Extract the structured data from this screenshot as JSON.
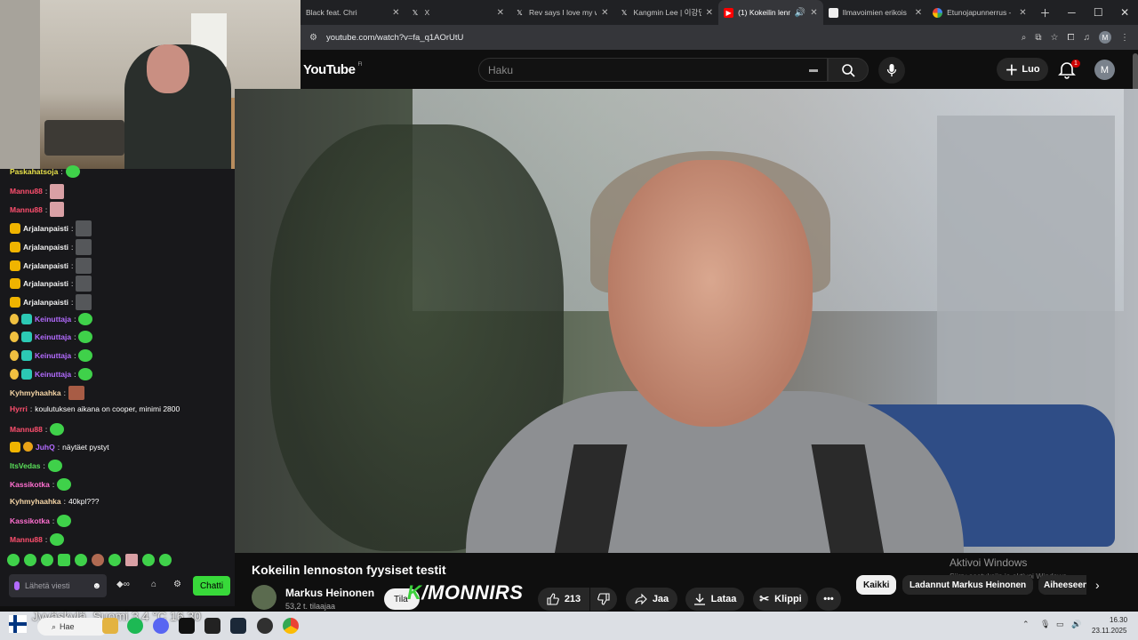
{
  "browser": {
    "tabs": [
      {
        "label": "Black feat. Chri",
        "icon": "x-icon"
      },
      {
        "label": "X",
        "icon": "x-icon"
      },
      {
        "label": "Rev says I love my w",
        "icon": "x-icon"
      },
      {
        "label": "Kangmin Lee | 이강민",
        "icon": "x-icon"
      },
      {
        "label": "(1) Kokeilin lenn",
        "icon": "youtube-icon",
        "active": true
      },
      {
        "label": "Ilmavoimien erikois",
        "icon": "page-icon"
      },
      {
        "label": "Etunojapunnerrus - ",
        "icon": "google-icon"
      }
    ],
    "url": "youtube.com/watch?v=fa_q1AOrUtU",
    "profile_initial": "M"
  },
  "youtube": {
    "logo": "YouTube",
    "region": "FI",
    "search_placeholder": "Haku",
    "create_label": "Luo",
    "notification_count": "1",
    "avatar_initial": "M",
    "video_title": "Kokeilin lennoston fyysiset testit",
    "channel_name": "Markus Heinonen",
    "subscribers": "53,2 t. tilaajaa",
    "subscribe_label": "Tila",
    "overlay_logo_k": "K",
    "overlay_logo_rest": "/MONNIRS",
    "likes": "213",
    "share_label": "Jaa",
    "download_label": "Lataa",
    "clip_label": "Klippi",
    "chips": [
      "Kaikki",
      "Ladannut Markus Heinonen",
      "Aiheeseen"
    ],
    "watermark_title": "Aktivoi Windows",
    "watermark_sub": "Siirry asetuksiin ja aktivoi Windows."
  },
  "chat": {
    "messages": [
      {
        "user": "Paskahatsoja",
        "color": "#e8e14a",
        "text": "",
        "emote": "green"
      },
      {
        "user": "Mannu88",
        "color": "#ff4f6e",
        "text": "",
        "emote": "pink"
      },
      {
        "user": "Mannu88",
        "color": "#ff4f6e",
        "text": "",
        "emote": "pink"
      },
      {
        "user": "Arjalanpaisti",
        "color": "#f2f2f2",
        "text": "",
        "emote": "dark",
        "badges": [
          "crown"
        ]
      },
      {
        "user": "Arjalanpaisti",
        "color": "#f2f2f2",
        "text": "",
        "emote": "dark",
        "badges": [
          "crown"
        ]
      },
      {
        "user": "Arjalanpaisti",
        "color": "#f2f2f2",
        "text": "",
        "emote": "dark",
        "badges": [
          "crown"
        ]
      },
      {
        "user": "Arjalanpaisti",
        "color": "#f2f2f2",
        "text": "",
        "emote": "dark",
        "badges": [
          "crown"
        ]
      },
      {
        "user": "Arjalanpaisti",
        "color": "#f2f2f2",
        "text": "",
        "emote": "dark",
        "badges": [
          "crown"
        ]
      },
      {
        "user": "Keinuttaja",
        "color": "#b36bff",
        "text": "",
        "emote": "green",
        "badges": [
          "drink",
          "teal"
        ]
      },
      {
        "user": "Keinuttaja",
        "color": "#b36bff",
        "text": "",
        "emote": "green",
        "badges": [
          "drink",
          "teal"
        ]
      },
      {
        "user": "Keinuttaja",
        "color": "#b36bff",
        "text": "",
        "emote": "green",
        "badges": [
          "drink",
          "teal"
        ]
      },
      {
        "user": "Keinuttaja",
        "color": "#b36bff",
        "text": "",
        "emote": "green",
        "badges": [
          "drink",
          "teal"
        ]
      },
      {
        "user": "Kyhmyhaahka",
        "color": "#f5d5a6",
        "text": "",
        "emote": "brown"
      },
      {
        "user": "Hyrri",
        "color": "#ff4f6e",
        "text": "koulutuksen aikana on cooper, minimi 2800",
        "emote": ""
      },
      {
        "user": "Mannu88",
        "color": "#ff4f6e",
        "text": "",
        "emote": "green"
      },
      {
        "user": "JuhQ",
        "color": "#b36bff",
        "text": "näytäet pystyt",
        "emote": "",
        "badges": [
          "crown",
          "coin"
        ]
      },
      {
        "user": "ItsVedas",
        "color": "#5ae05a",
        "text": "",
        "emote": "green"
      },
      {
        "user": "Kassikotka",
        "color": "#ff6fd0",
        "text": "",
        "emote": "green"
      },
      {
        "user": "Kyhmyhaahka",
        "color": "#f5d5a6",
        "text": "40kpl???",
        "emote": ""
      },
      {
        "user": "Kassikotka",
        "color": "#ff6fd0",
        "text": "",
        "emote": "green"
      },
      {
        "user": "Mannu88",
        "color": "#ff4f6e",
        "text": "",
        "emote": "green"
      }
    ],
    "input_placeholder": "Lähetä viesti",
    "send_label": "Chatti"
  },
  "taskbar": {
    "weather": "Jyväskylä, Suomi  3,4 °C  16.30",
    "search_label": "Hae",
    "time": "16.30",
    "date": "23.11.2025"
  }
}
